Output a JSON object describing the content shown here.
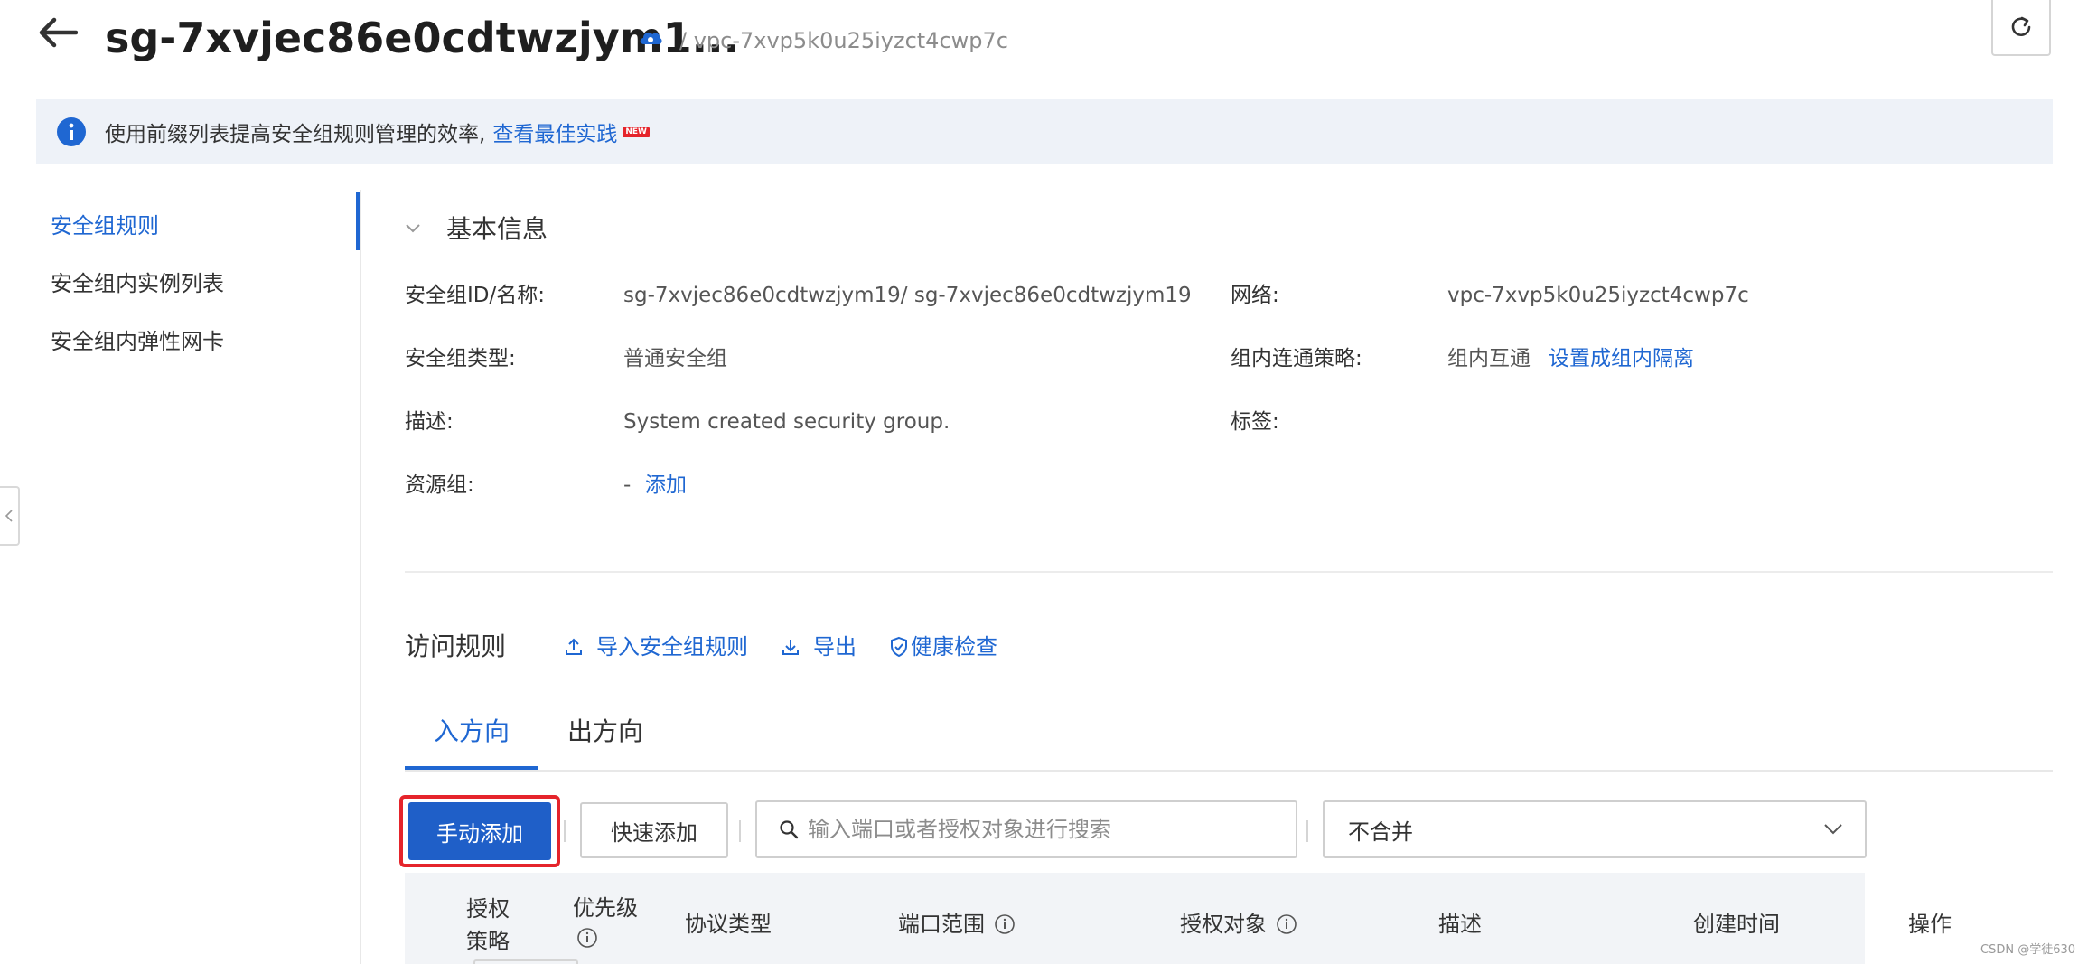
{
  "header": {
    "title": "sg-7xvjec86e0cdtwzjym1...",
    "vpc_crumb": "/ vpc-7xvp5k0u25iyzct4cwp7c"
  },
  "notice": {
    "text": "使用前缀列表提高安全组规则管理的效率,",
    "link": "查看最佳实践",
    "badge": "NEW"
  },
  "nav": {
    "items": [
      {
        "label": "安全组规则",
        "active": true
      },
      {
        "label": "安全组内实例列表",
        "active": false
      },
      {
        "label": "安全组内弹性网卡",
        "active": false
      }
    ]
  },
  "basic_info": {
    "title": "基本信息",
    "fields": {
      "sg_id_label": "安全组ID/名称:",
      "sg_id_value": "sg-7xvjec86e0cdtwzjym19/ sg-7xvjec86e0cdtwzjym19",
      "network_label": "网络:",
      "network_value": "vpc-7xvp5k0u25iyzct4cwp7c",
      "type_label": "安全组类型:",
      "type_value": "普通安全组",
      "policy_label": "组内连通策略:",
      "policy_value": "组内互通",
      "policy_link": "设置成组内隔离",
      "desc_label": "描述:",
      "desc_value": "System created security group.",
      "tags_label": "标签:",
      "rg_label": "资源组:",
      "rg_value": "-",
      "rg_link": "添加"
    }
  },
  "rules": {
    "title": "访问规则",
    "import_label": "导入安全组规则",
    "export_label": "导出",
    "health_label": "健康检查",
    "tabs": [
      {
        "label": "入方向",
        "active": true
      },
      {
        "label": "出方向",
        "active": false
      }
    ],
    "toolbar": {
      "manual_add": "手动添加",
      "quick_add": "快速添加",
      "search_placeholder": "输入端口或者授权对象进行搜索",
      "merge_select": "不合并"
    },
    "columns": {
      "policy": "授权策略",
      "priority": "优先级",
      "protocol": "协议类型",
      "port": "端口范围",
      "target": "授权对象",
      "desc": "描述",
      "created": "创建时间",
      "ops": "操作"
    }
  },
  "watermark": "CSDN @学徒630",
  "colors": {
    "accent": "#1f67d2",
    "primary_button": "#1f5fc8",
    "highlight": "#e5242b",
    "notice_bg": "#eef2f8"
  }
}
